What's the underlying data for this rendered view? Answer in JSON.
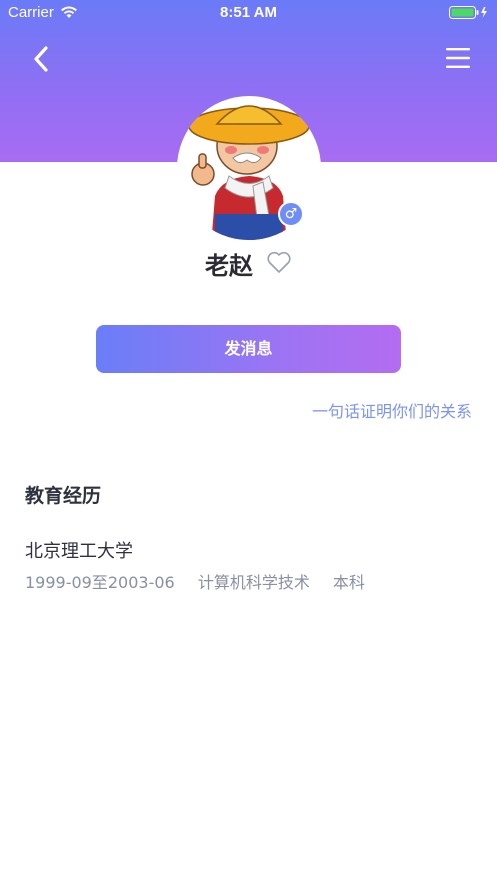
{
  "status_bar": {
    "carrier": "Carrier",
    "time": "8:51 AM"
  },
  "header": {
    "gradient_top": "#6a7bf7",
    "gradient_bottom": "#a86cf2",
    "back_icon": "chevron-left-icon",
    "menu_icon": "hamburger-menu-icon"
  },
  "profile": {
    "name": "老赵",
    "gender_symbol": "♂",
    "gender_color": "#6f8df7",
    "favorite_icon": "heart-outline-icon"
  },
  "actions": {
    "send_message_label": "发消息",
    "relationship_link": "一句话证明你们的关系"
  },
  "education": {
    "title": "教育经历",
    "items": [
      {
        "school": "北京理工大学",
        "period": "1999-09至2003-06",
        "major": "计算机科学技术",
        "degree": "本科"
      }
    ]
  }
}
